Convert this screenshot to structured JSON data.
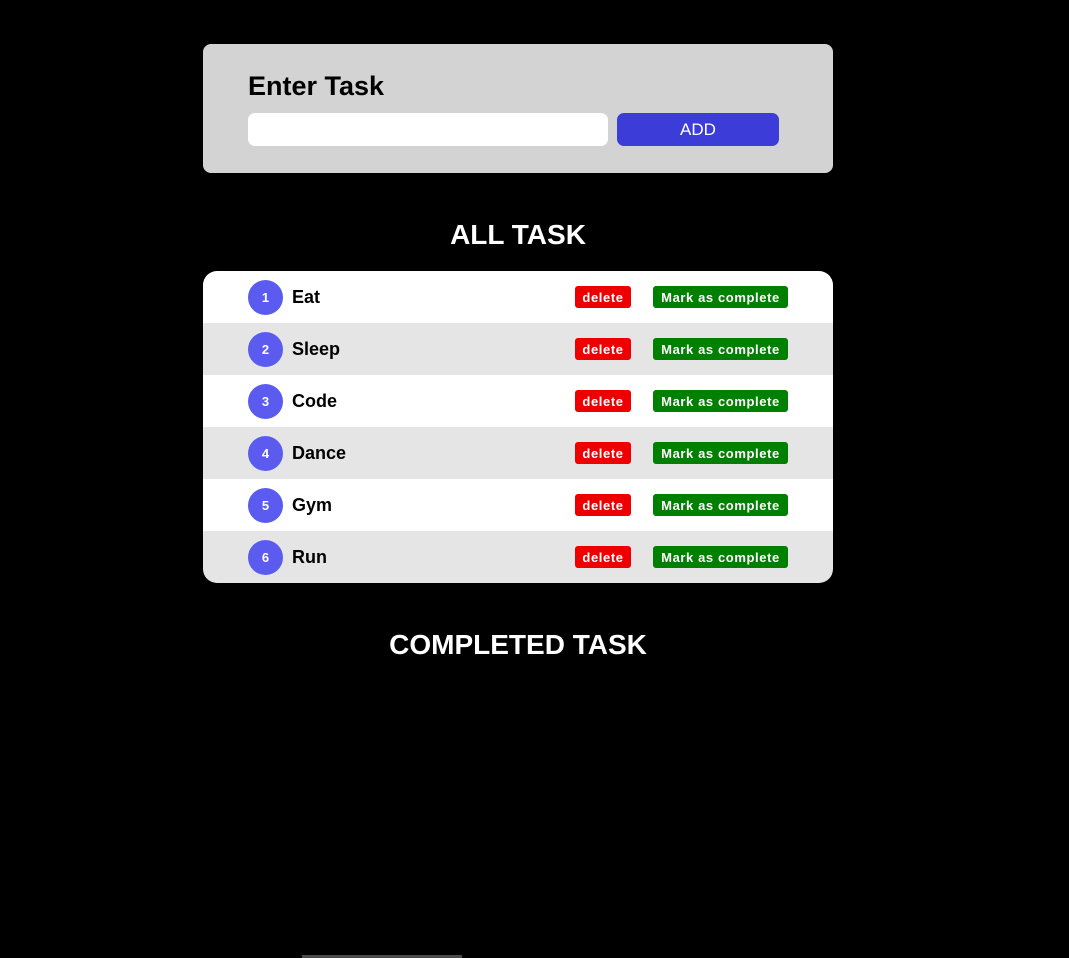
{
  "entry": {
    "title": "Enter Task",
    "input_value": "",
    "input_placeholder": "",
    "add_label": "ADD"
  },
  "all_tasks": {
    "heading": "ALL TASK",
    "items": [
      {
        "number": "1",
        "name": "Eat",
        "delete_label": "delete",
        "complete_label": "Mark as complete"
      },
      {
        "number": "2",
        "name": "Sleep",
        "delete_label": "delete",
        "complete_label": "Mark as complete"
      },
      {
        "number": "3",
        "name": "Code",
        "delete_label": "delete",
        "complete_label": "Mark as complete"
      },
      {
        "number": "4",
        "name": "Dance",
        "delete_label": "delete",
        "complete_label": "Mark as complete"
      },
      {
        "number": "5",
        "name": "Gym",
        "delete_label": "delete",
        "complete_label": "Mark as complete"
      },
      {
        "number": "6",
        "name": "Run",
        "delete_label": "delete",
        "complete_label": "Mark as complete"
      }
    ]
  },
  "completed_tasks": {
    "heading": "COMPLETED TASK",
    "items": []
  },
  "colors": {
    "page_background": "#000000",
    "entry_card": "#d3d3d3",
    "add_button": "#3c3cd8",
    "number_badge": "#5b5bf0",
    "delete_button": "#ee0000",
    "complete_button": "#008000",
    "row_even": "#e5e5e5",
    "row_odd": "#ffffff"
  }
}
